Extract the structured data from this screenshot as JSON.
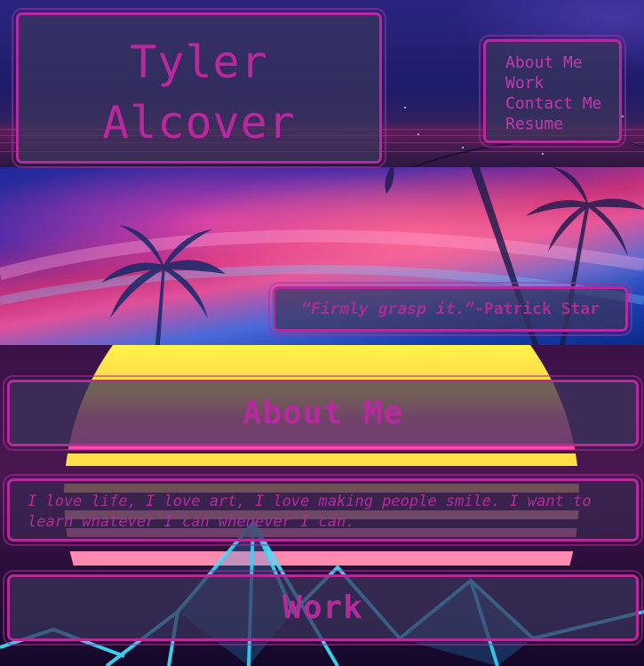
{
  "header": {
    "first_name": "Tyler",
    "last_name": "Alcover"
  },
  "nav": {
    "items": [
      {
        "label": "About Me"
      },
      {
        "label": "Work"
      },
      {
        "label": "Contact Me"
      },
      {
        "label": "Resume"
      }
    ]
  },
  "quote": {
    "text": "“Firmly grasp it.”",
    "author": " -Patrick Star"
  },
  "sections": {
    "about": {
      "heading": "About Me",
      "body": "I love life, I love art, I love making people smile. I want to learn whatever I can whenever I can."
    },
    "work": {
      "heading": "Work"
    }
  },
  "colors": {
    "accent": "#b52a9c",
    "panel_bg": "#3a345c"
  }
}
